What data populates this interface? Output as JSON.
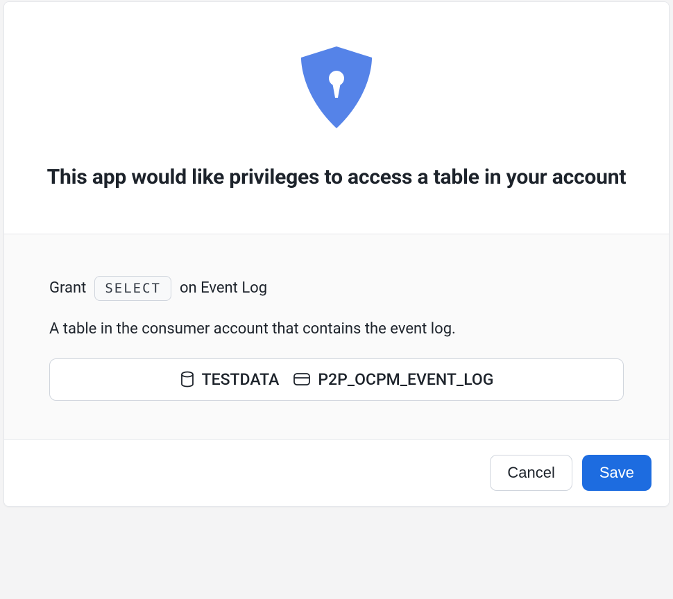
{
  "header": {
    "title": "This app would like privileges to access a table in your account"
  },
  "body": {
    "grant_prefix": "Grant",
    "privilege": "SELECT",
    "grant_suffix": "on Event Log",
    "description": "A table in the consumer account that contains the event log.",
    "database": "TESTDATA",
    "table": "P2P_OCPM_EVENT_LOG"
  },
  "footer": {
    "cancel_label": "Cancel",
    "save_label": "Save"
  },
  "icons": {
    "shield": "shield-keyhole-icon",
    "database": "database-icon",
    "table": "table-icon"
  },
  "colors": {
    "accent": "#5583e8",
    "primary_button": "#1d6ce0"
  }
}
